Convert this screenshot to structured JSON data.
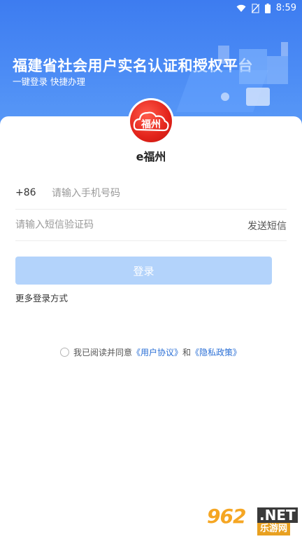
{
  "status_bar": {
    "time": "8:59"
  },
  "banner": {
    "title": "福建省社会用户实名认证和授权平台",
    "subtitle": "一键登录  快捷办理"
  },
  "logo": {
    "text": "福州"
  },
  "app_name": "e福州",
  "form": {
    "country_code": "+86",
    "phone_placeholder": "请输入手机号码",
    "code_placeholder": "请输入短信验证码",
    "send_sms_label": "发送短信",
    "login_label": "登录",
    "more_login_label": "更多登录方式"
  },
  "agreement": {
    "prefix": "我已阅读并同意",
    "user_agreement": "《用户协议》",
    "and": "和",
    "privacy_policy": "《隐私政策》"
  },
  "watermark": {
    "number": "962",
    "net": ".NET",
    "cn": "乐游网"
  },
  "colors": {
    "header_blue": "#4c8cf5",
    "login_button_disabled": "#b3d3fb",
    "link_blue": "#2a6fd6",
    "logo_red": "#e2231a"
  }
}
